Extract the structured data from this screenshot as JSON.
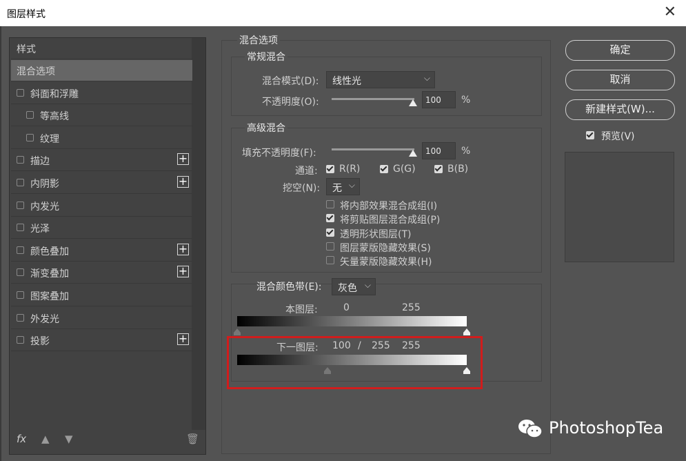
{
  "window": {
    "title": "图层样式",
    "close_icon": "close-icon"
  },
  "left_panel": {
    "header": "样式",
    "items": [
      {
        "label": "混合选项",
        "checkbox": false,
        "plus": false,
        "selected": true,
        "indent": false
      },
      {
        "label": "斜面和浮雕",
        "checkbox": true,
        "plus": false,
        "selected": false,
        "indent": false
      },
      {
        "label": "等高线",
        "checkbox": true,
        "plus": false,
        "selected": false,
        "indent": true
      },
      {
        "label": "纹理",
        "checkbox": true,
        "plus": false,
        "selected": false,
        "indent": true
      },
      {
        "label": "描边",
        "checkbox": true,
        "plus": true,
        "selected": false,
        "indent": false
      },
      {
        "label": "内阴影",
        "checkbox": true,
        "plus": true,
        "selected": false,
        "indent": false
      },
      {
        "label": "内发光",
        "checkbox": true,
        "plus": false,
        "selected": false,
        "indent": false
      },
      {
        "label": "光泽",
        "checkbox": true,
        "plus": false,
        "selected": false,
        "indent": false
      },
      {
        "label": "颜色叠加",
        "checkbox": true,
        "plus": true,
        "selected": false,
        "indent": false
      },
      {
        "label": "渐变叠加",
        "checkbox": true,
        "plus": true,
        "selected": false,
        "indent": false
      },
      {
        "label": "图案叠加",
        "checkbox": true,
        "plus": false,
        "selected": false,
        "indent": false
      },
      {
        "label": "外发光",
        "checkbox": true,
        "plus": false,
        "selected": false,
        "indent": false
      },
      {
        "label": "投影",
        "checkbox": true,
        "plus": true,
        "selected": false,
        "indent": false
      }
    ],
    "bottom": {
      "fx": "fx",
      "up_icon": "arrow-up-icon",
      "down_icon": "arrow-down-icon",
      "trash_icon": "trash-icon"
    }
  },
  "blend_options": {
    "title": "混合选项",
    "general": {
      "title": "常规混合",
      "mode_label": "混合模式(D):",
      "mode_value": "线性光",
      "opacity_label": "不透明度(O):",
      "opacity_value": "100",
      "opacity_unit": "%"
    },
    "advanced": {
      "title": "高级混合",
      "fill_label": "填充不透明度(F):",
      "fill_value": "100",
      "fill_unit": "%",
      "channels_label": "通道:",
      "channels": [
        {
          "label": "R(R)",
          "checked": true
        },
        {
          "label": "G(G)",
          "checked": true
        },
        {
          "label": "B(B)",
          "checked": true
        }
      ],
      "knockout_label": "挖空(N):",
      "knockout_value": "无",
      "options": [
        {
          "label": "将内部效果混合成组(I)",
          "checked": false
        },
        {
          "label": "将剪贴图层混合成组(P)",
          "checked": true
        },
        {
          "label": "透明形状图层(T)",
          "checked": true
        },
        {
          "label": "图层蒙版隐藏效果(S)",
          "checked": false
        },
        {
          "label": "矢量蒙版隐藏效果(H)",
          "checked": false
        }
      ]
    },
    "blend_if": {
      "label": "混合颜色带(E):",
      "value": "灰色",
      "this_layer": {
        "label": "本图层:",
        "low": "0",
        "high": "255",
        "low_value": 0,
        "high_value": 255
      },
      "underlying": {
        "label": "下一图层:",
        "low": "100",
        "sep": "/",
        "low2": "255",
        "high": "255",
        "low_value": 100,
        "high_value": 255
      }
    }
  },
  "buttons": {
    "ok": "确定",
    "cancel": "取消",
    "new_style": "新建样式(W)...",
    "preview": "预览(V)",
    "preview_checked": true
  },
  "watermark": {
    "text": "PhotoshopTea",
    "icon": "wechat-icon"
  },
  "colors": {
    "background": "#535353",
    "panel": "#424242",
    "selected": "#666666",
    "highlight": "#d11c1c"
  }
}
